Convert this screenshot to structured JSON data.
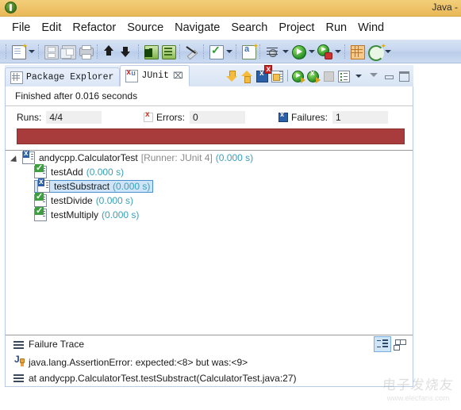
{
  "window": {
    "title": "Java -",
    "app_icon": "eclipse-icon"
  },
  "menubar": {
    "items": [
      {
        "label": "File",
        "name": "menu-file"
      },
      {
        "label": "Edit",
        "name": "menu-edit"
      },
      {
        "label": "Refactor",
        "name": "menu-refactor"
      },
      {
        "label": "Source",
        "name": "menu-source"
      },
      {
        "label": "Navigate",
        "name": "menu-navigate"
      },
      {
        "label": "Search",
        "name": "menu-search"
      },
      {
        "label": "Project",
        "name": "menu-project"
      },
      {
        "label": "Run",
        "name": "menu-run"
      },
      {
        "label": "Wind",
        "name": "menu-window"
      }
    ]
  },
  "toolbar": {
    "icons": [
      "new-document-icon",
      "dropdown-arrow-icon",
      "save-icon",
      "save-all-icon",
      "print-icon",
      "export-icon",
      "import-icon",
      "download-icon",
      "database-icon",
      "no-pen-icon",
      "checkmark-icon",
      "dropdown-arrow-icon",
      "new-class-icon",
      "debug-icon",
      "dropdown-arrow-icon",
      "run-icon",
      "dropdown-arrow-icon",
      "run-config-icon",
      "dropdown-arrow-icon",
      "package-icon",
      "coverage-icon",
      "dropdown-arrow-icon"
    ]
  },
  "view": {
    "tabs": [
      {
        "label": "Package Explorer",
        "icon": "package-explorer-icon",
        "active": false,
        "closable": false
      },
      {
        "label": "JUnit",
        "icon": "junit-icon",
        "active": true,
        "closable": true,
        "close_glyph": "⌧"
      }
    ],
    "tools": [
      "next-failure-icon",
      "previous-failure-icon",
      "show-failures-only-icon",
      "scroll-lock-icon",
      "rerun-test-icon",
      "rerun-failed-tests-icon",
      "stop-icon",
      "test-run-history-icon",
      "view-menu-icon",
      "minimize-arrow-icon",
      "minimize-icon",
      "maximize-icon"
    ]
  },
  "junit": {
    "status": "Finished after 0.016 seconds",
    "counters": [
      {
        "label": "Runs:",
        "value": "4/4",
        "icon": null,
        "name": "runs-counter"
      },
      {
        "label": "Errors:",
        "value": "0",
        "icon": "error-icon",
        "name": "errors-counter"
      },
      {
        "label": "Failures:",
        "value": "1",
        "icon": "failure-icon",
        "name": "failures-counter"
      }
    ],
    "progress": {
      "state": "failed",
      "color": "#a83c3c",
      "percent": 100
    },
    "tree": {
      "root": {
        "name": "andycpp.CalculatorTest",
        "runner": "[Runner: JUnit 4]",
        "time": "(0.000 s)",
        "icon": "test-class-failed-icon",
        "expanded": true
      },
      "children": [
        {
          "name": "testAdd",
          "time": "(0.000 s)",
          "icon": "test-passed-icon",
          "selected": false
        },
        {
          "name": "testSubstract",
          "time": "(0.000 s)",
          "icon": "test-failed-icon",
          "selected": true
        },
        {
          "name": "testDivide",
          "time": "(0.000 s)",
          "icon": "test-passed-icon",
          "selected": false
        },
        {
          "name": "testMultiply",
          "time": "(0.000 s)",
          "icon": "test-passed-icon",
          "selected": false
        }
      ]
    },
    "failure_trace": {
      "title": "Failure Trace",
      "tools": [
        {
          "name": "filter-stack-trace-button",
          "icon": "filter-stack-trace-icon",
          "active": true
        },
        {
          "name": "compare-result-button",
          "icon": "compare-result-icon",
          "active": false
        }
      ],
      "lines": [
        {
          "text": "java.lang.AssertionError: expected:<8> but was:<9>",
          "icon": "java-exception-icon"
        },
        {
          "text": "at andycpp.CalculatorTest.testSubstract(CalculatorTest.java:27)",
          "icon": "stack-frame-icon"
        }
      ]
    }
  },
  "watermark": {
    "cn": "电子发烧友",
    "url": "www.elecfans.com"
  }
}
